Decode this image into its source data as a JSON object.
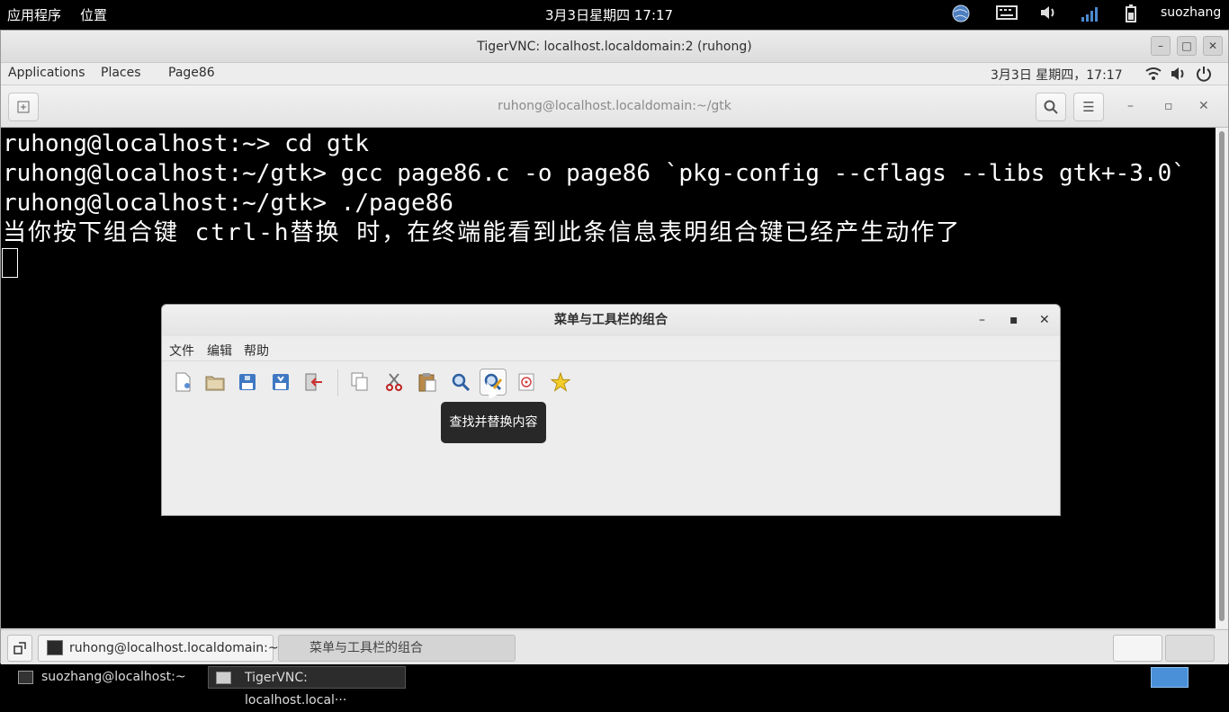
{
  "host_topbar": {
    "applications": "应用程序",
    "places": "位置",
    "clock": "3月3日星期四 17:17",
    "user": "suozhang"
  },
  "vnc": {
    "title": "TigerVNC: localhost.localdomain:2 (ruhong)"
  },
  "guest_panel": {
    "applications": "Applications",
    "places": "Places",
    "app_name": "Page86",
    "clock": "3月3日 星期四，17:17"
  },
  "terminal": {
    "title": "ruhong@localhost.localdomain:~/gtk",
    "lines": [
      "ruhong@localhost:~> cd gtk",
      "ruhong@localhost:~/gtk> gcc page86.c -o page86 `pkg-config --cflags --libs gtk+-3.0`",
      "ruhong@localhost:~/gtk> ./page86",
      "当你按下组合键 ctrl-h替换 时，在终端能看到此条信息表明组合键已经产生动作了"
    ]
  },
  "app_window": {
    "title": "菜单与工具栏的组合",
    "menus": [
      "文件",
      "编辑",
      "帮助"
    ],
    "tooltip": "查找并替换内容"
  },
  "guest_taskbar": {
    "terminal_task": "ruhong@localhost.localdomain:~/...",
    "app_task": "菜单与工具栏的组合"
  },
  "host_taskbar": {
    "terminal_task": "suozhang@localhost:~",
    "vnc_task": "TigerVNC: localhost.local···"
  }
}
